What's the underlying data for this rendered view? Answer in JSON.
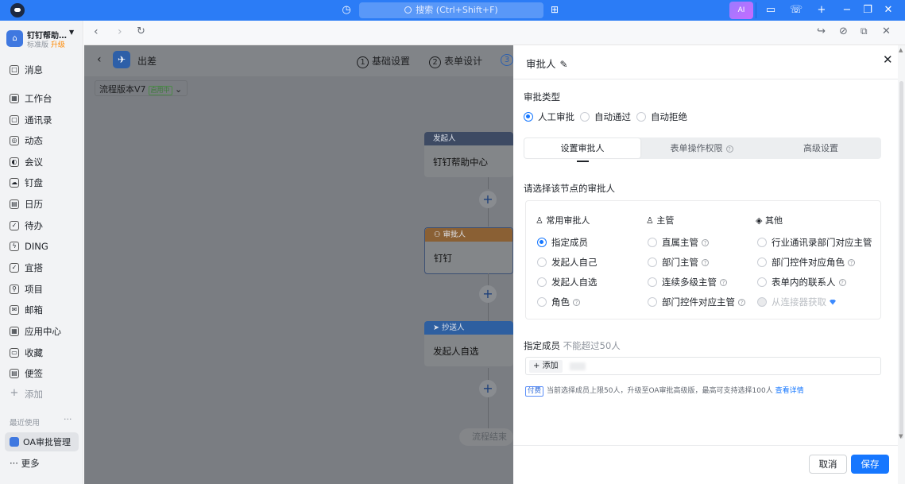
{
  "titlebar": {
    "search_placeholder": "搜索 (Ctrl+Shift+F)",
    "ai_label": "AI"
  },
  "sidebar": {
    "org_name": "钉钉帮助…",
    "org_tier": "标准版",
    "org_upgrade": "升级",
    "items": [
      {
        "label": "消息",
        "icon": "□"
      },
      {
        "label": "工作台",
        "icon": "▦"
      },
      {
        "label": "通讯录",
        "icon": "▢"
      },
      {
        "label": "动态",
        "icon": "◎"
      },
      {
        "label": "会议",
        "icon": "◐"
      },
      {
        "label": "钉盘",
        "icon": "☁"
      },
      {
        "label": "日历",
        "icon": "▤"
      },
      {
        "label": "待办",
        "icon": "✓"
      },
      {
        "label": "DING",
        "icon": "ϟ"
      },
      {
        "label": "宜搭",
        "icon": "✓"
      },
      {
        "label": "项目",
        "icon": "⚲"
      },
      {
        "label": "邮箱",
        "icon": "✉"
      },
      {
        "label": "应用中心",
        "icon": "▦"
      },
      {
        "label": "收藏",
        "icon": "▭"
      },
      {
        "label": "便签",
        "icon": "▤"
      }
    ],
    "add_label": "添加",
    "recent_label": "最近使用",
    "recent_item": "OA审批管理",
    "more_label": "更多"
  },
  "editor": {
    "title": "出差",
    "steps": [
      {
        "num": "1",
        "label": "基础设置"
      },
      {
        "num": "2",
        "label": "表单设计"
      }
    ],
    "step3_num": "3",
    "version": "流程版本V7",
    "version_tag": "启用中",
    "nodes": [
      {
        "head": "发起人",
        "body": "钉钉帮助中心",
        "color": "#3d4a63"
      },
      {
        "head": "审批人",
        "body": "钉钉",
        "color": "#8a6034"
      },
      {
        "head": "抄送人",
        "body": "发起人自选",
        "color": "#2e5fa0"
      }
    ],
    "end_label": "流程结束"
  },
  "panel": {
    "title": "审批人",
    "type_label": "审批类型",
    "type_options": [
      "人工审批",
      "自动通过",
      "自动拒绝"
    ],
    "tabs": [
      "设置审批人",
      "表单操作权限",
      "高级设置"
    ],
    "choose_label": "请选择该节点的审批人",
    "columns": [
      {
        "head": "常用审批人",
        "options": [
          {
            "label": "指定成员",
            "q": false
          },
          {
            "label": "发起人自己",
            "q": false
          },
          {
            "label": "发起人自选",
            "q": false
          },
          {
            "label": "角色",
            "q": true
          }
        ]
      },
      {
        "head": "主管",
        "options": [
          {
            "label": "直属主管",
            "q": true
          },
          {
            "label": "部门主管",
            "q": true
          },
          {
            "label": "连续多级主管",
            "q": true
          },
          {
            "label": "部门控件对应主管",
            "q": true
          }
        ]
      },
      {
        "head": "其他",
        "options": [
          {
            "label": "行业通讯录部门对应主管",
            "q": false
          },
          {
            "label": "部门控件对应角色",
            "q": true
          },
          {
            "label": "表单内的联系人",
            "q": true
          },
          {
            "label": "从连接器获取",
            "q": false
          }
        ]
      }
    ],
    "member_label": "指定成员",
    "member_hint": "不能超过50人",
    "add_label": "添加",
    "note_tag": "付费",
    "note_text": "当前选择成员上限50人，升级至OA审批高级版，最高可支持选择100人",
    "note_link": "查看详情",
    "cancel_label": "取消",
    "save_label": "保存",
    "accent_color": "#1677ff"
  }
}
